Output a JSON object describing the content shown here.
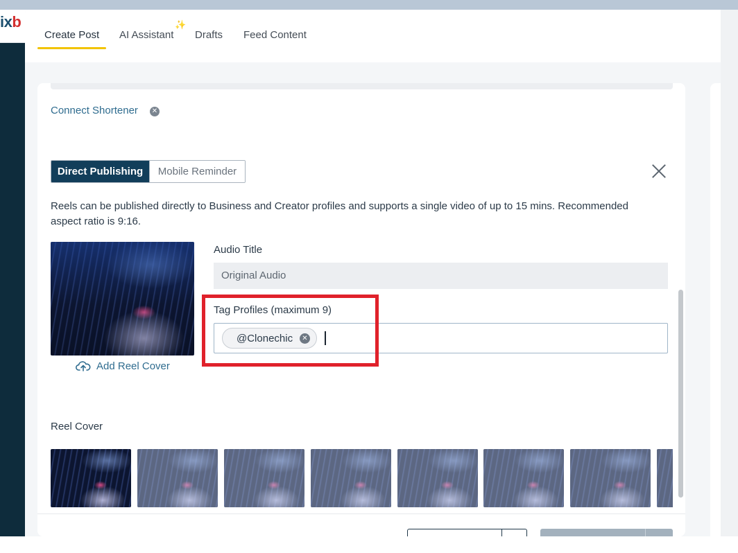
{
  "background": {
    "logo_text": "ix",
    "logo_accent": "b"
  },
  "tabs": [
    {
      "label": "Create Post",
      "active": true
    },
    {
      "label": "AI Assistant",
      "active": false
    },
    {
      "label": "Drafts",
      "active": false
    },
    {
      "label": "Feed Content",
      "active": false
    }
  ],
  "sparkle_glyph": "✨",
  "connect_shortener": "Connect Shortener",
  "publishing_mode": {
    "direct": "Direct Publishing",
    "mobile": "Mobile Reminder"
  },
  "description": "Reels can be published directly to Business and Creator profiles and supports a single video of up to 15 mins. Recommended aspect ratio is 9:16.",
  "add_reel_cover": "Add Reel Cover",
  "audio": {
    "label": "Audio Title",
    "value": "Original Audio"
  },
  "tag_profiles": {
    "label": "Tag Profiles (maximum 9)",
    "tags": [
      "@Clonechic"
    ]
  },
  "reel_cover": {
    "label": "Reel Cover",
    "frame_count": 8
  },
  "colors": {
    "accent_underline": "#f2c300",
    "primary_dark": "#123e5a",
    "link": "#2f6c8f",
    "highlight": "#e0212b"
  }
}
